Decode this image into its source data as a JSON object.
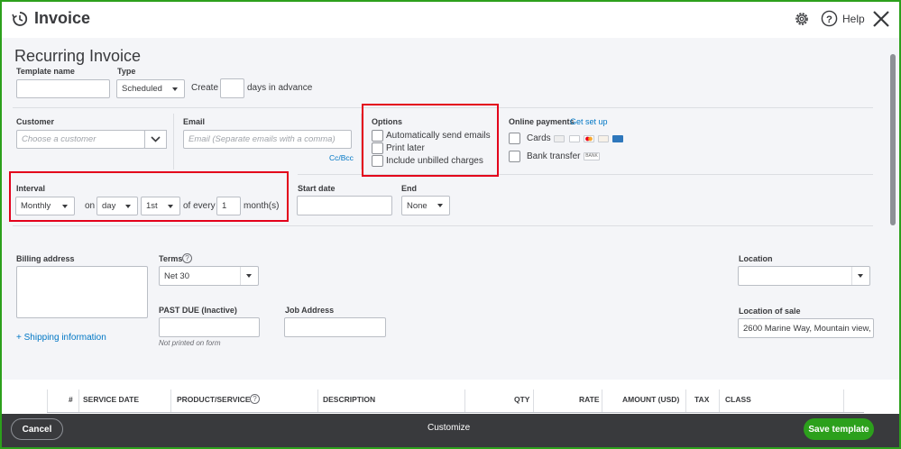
{
  "header": {
    "title": "Invoice",
    "help_label": "Help"
  },
  "form": {
    "heading": "Recurring Invoice",
    "template_name": {
      "label": "Template name",
      "value": ""
    },
    "type": {
      "label": "Type",
      "value": "Scheduled"
    },
    "create": {
      "prefix": "Create",
      "value": "",
      "suffix": "days in advance"
    },
    "customer": {
      "label": "Customer",
      "placeholder": "Choose a customer"
    },
    "email": {
      "label": "Email",
      "placeholder": "Email (Separate emails with a comma)",
      "cc_bcc": "Cc/Bcc"
    },
    "options": {
      "label": "Options",
      "items": [
        "Automatically send emails",
        "Print later",
        "Include unbilled charges"
      ]
    },
    "online_payments": {
      "label": "Online payments",
      "setup_link": "Get set up",
      "cards": "Cards",
      "bank_transfer": "Bank transfer",
      "bank_badge": "BANK"
    },
    "interval": {
      "label": "Interval",
      "value": "Monthly",
      "on": "on",
      "day": "day",
      "ordinal": "1st",
      "of_every": "of every",
      "count": "1",
      "unit": "month(s)"
    },
    "start_date": {
      "label": "Start date",
      "value": ""
    },
    "end": {
      "label": "End",
      "value": "None"
    },
    "billing_address": {
      "label": "Billing address",
      "value": ""
    },
    "terms": {
      "label": "Terms",
      "value": "Net 30"
    },
    "past_due": {
      "label": "PAST DUE (Inactive)",
      "note": "Not printed on form"
    },
    "job_address": {
      "label": "Job Address"
    },
    "shipping_link": "+ Shipping information",
    "location": {
      "label": "Location",
      "value": ""
    },
    "location_of_sale": {
      "label": "Location of sale",
      "value": "2600 Marine Way, Mountain view,"
    }
  },
  "table": {
    "columns": [
      "#",
      "SERVICE DATE",
      "PRODUCT/SERVICE",
      "DESCRIPTION",
      "QTY",
      "RATE",
      "AMOUNT (USD)",
      "TAX",
      "CLASS"
    ]
  },
  "footer": {
    "cancel": "Cancel",
    "customize": "Customize",
    "save": "Save template"
  },
  "colors": {
    "accent": "#2ca01c",
    "link": "#0077c5",
    "highlight": "#e3001b",
    "footer": "#393a3d"
  }
}
